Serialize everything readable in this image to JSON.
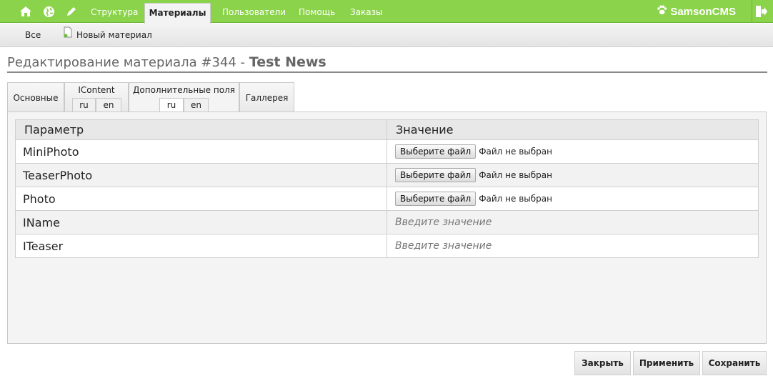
{
  "topbar": {
    "icons": [
      "home-icon",
      "globe-icon",
      "pencil-icon"
    ],
    "nav": [
      "Структура",
      "Материалы",
      "Пользователи",
      "Помощь",
      "Заказы"
    ],
    "active_nav": "Материалы",
    "brand": "SamsonCMS",
    "brand_icon": "paw-icon",
    "exit_icon": "logout-icon",
    "accent_color": "#8bd34b"
  },
  "subbar": {
    "all_label": "Все",
    "new_material_label": "Новый материал",
    "new_material_icon": "document-icon"
  },
  "title": {
    "prefix": "Редактирование материала #344 - ",
    "name": "Test News"
  },
  "tabs": {
    "main": "Основные",
    "icontent": "IContent",
    "extra": "Дополнительные поля",
    "gallery": "Галлерея",
    "langs": [
      "ru",
      "en"
    ],
    "active_tab": "Дополнительные поля",
    "active_lang": "ru"
  },
  "table": {
    "headers": [
      "Параметр",
      "Значение"
    ],
    "rows": [
      {
        "param": "MiniPhoto",
        "type": "file",
        "button": "Выберите файл",
        "status": "Файл не выбран"
      },
      {
        "param": "TeaserPhoto",
        "type": "file",
        "button": "Выберите файл",
        "status": "Файл не выбран"
      },
      {
        "param": "Photo",
        "type": "file",
        "button": "Выберите файл",
        "status": "Файл не выбран"
      },
      {
        "param": "IName",
        "type": "text",
        "placeholder": "Введите значение"
      },
      {
        "param": "ITeaser",
        "type": "text",
        "placeholder": "Введите значение"
      }
    ]
  },
  "buttons": {
    "close": "Закрыть",
    "apply": "Применить",
    "save": "Сохранить"
  }
}
